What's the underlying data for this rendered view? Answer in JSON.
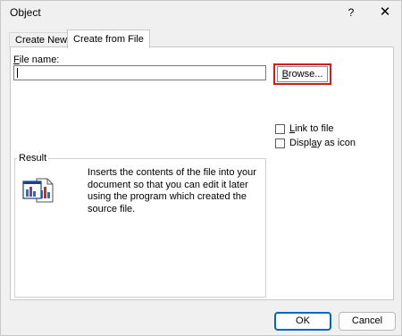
{
  "window": {
    "title": "Object",
    "help_glyph": "?",
    "close_glyph": "✕"
  },
  "tabs": [
    {
      "label": "Create New",
      "active": false
    },
    {
      "label": "Create from File",
      "active": true
    }
  ],
  "file_name": {
    "label_prefix": "F",
    "label_rest": "ile name:",
    "value": ""
  },
  "browse": {
    "label_pre": "B",
    "label_rest": "rowse...",
    "highlight_color": "#d21d1d"
  },
  "options": [
    {
      "label_pre": "",
      "label_u": "L",
      "label_post": "ink to file",
      "checked": false
    },
    {
      "label_pre": "Displ",
      "label_u": "a",
      "label_post": "y as icon",
      "checked": false
    }
  ],
  "result": {
    "legend": "Result",
    "text": "Inserts the contents of the file into your document so that you can edit it later using the program which created the source file.",
    "icon": "insert-file-icon"
  },
  "buttons": {
    "ok": "OK",
    "cancel": "Cancel"
  },
  "colors": {
    "accent": "#0067c0",
    "highlight": "#d21d1d"
  }
}
